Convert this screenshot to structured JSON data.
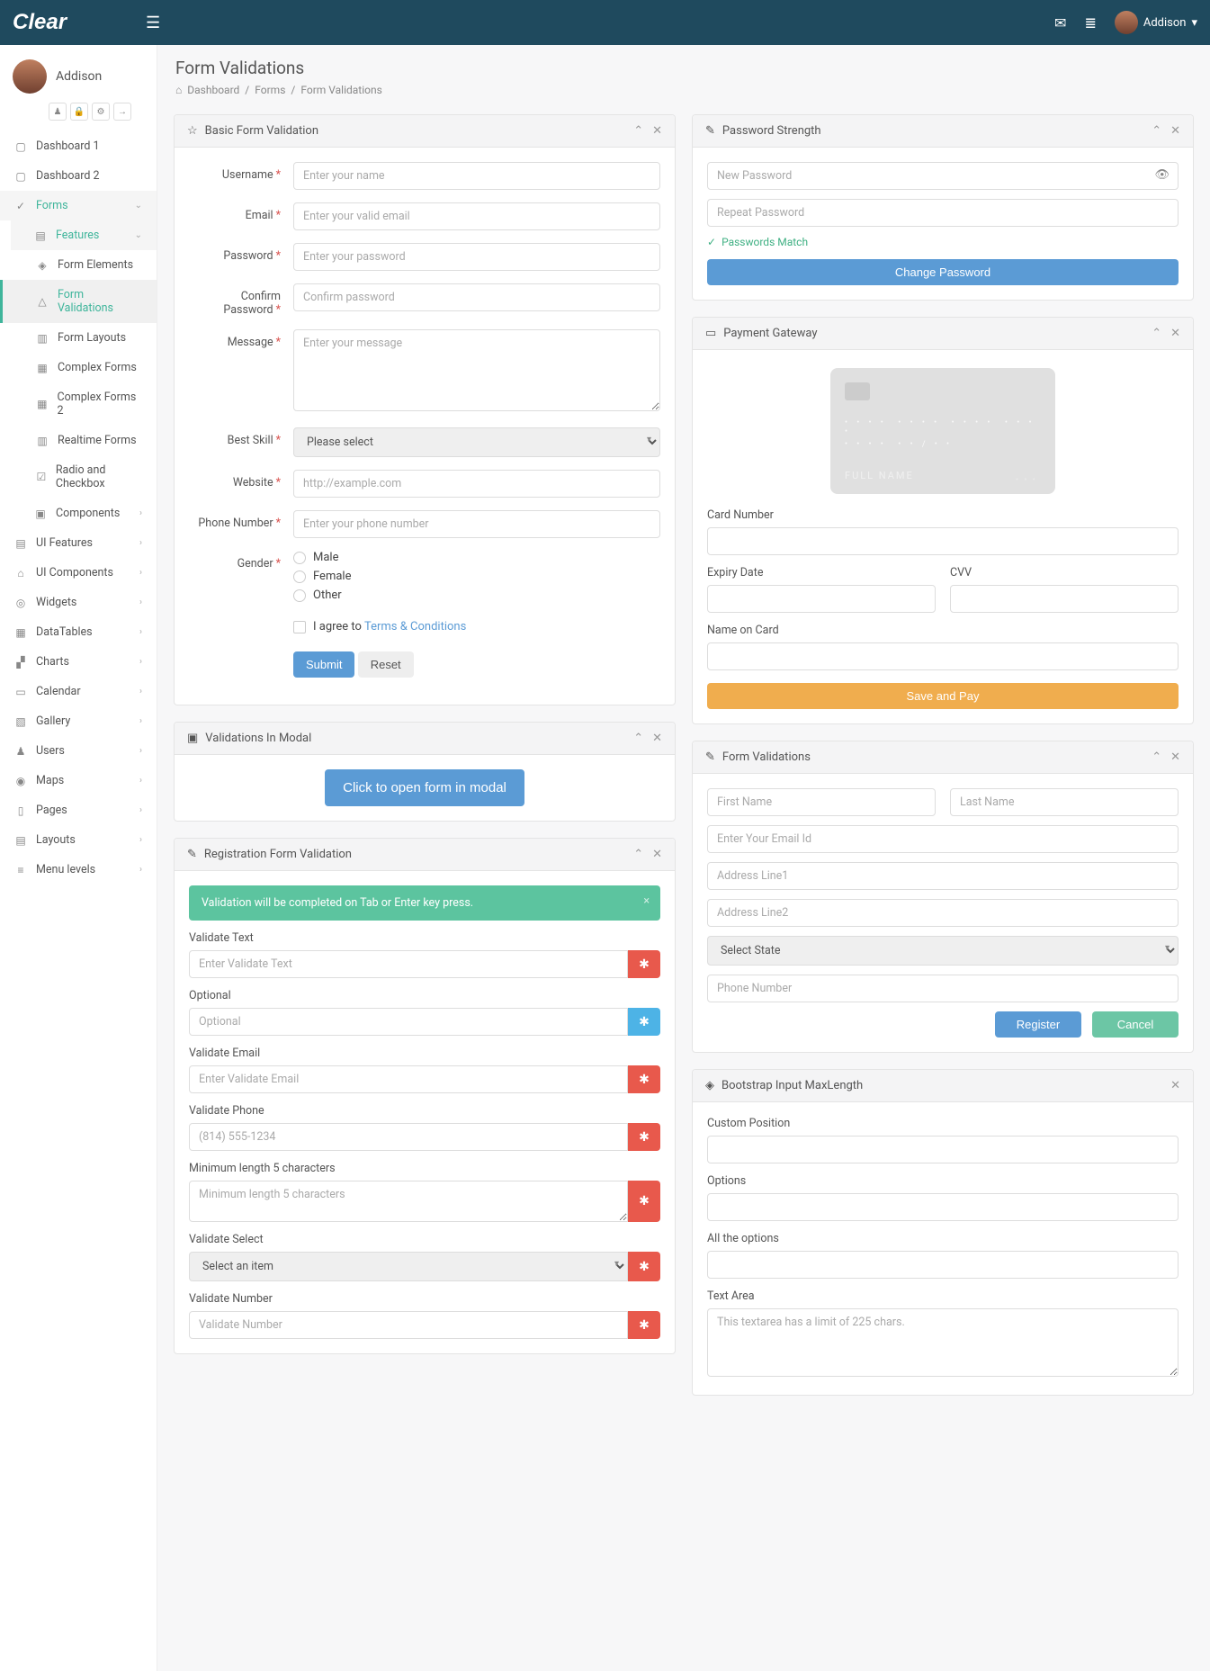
{
  "brand": "Clear",
  "user": {
    "name": "Addison"
  },
  "page": {
    "title": "Form Validations",
    "breadcrumb": [
      "Dashboard",
      "Forms",
      "Form Validations"
    ]
  },
  "sidebar": {
    "items": [
      {
        "label": "Dashboard 1",
        "icon": "▢"
      },
      {
        "label": "Dashboard 2",
        "icon": "▢"
      },
      {
        "label": "Forms",
        "icon": "✓",
        "active": true
      },
      {
        "label": "Features",
        "icon": "▤",
        "active": true,
        "sub": true
      },
      {
        "label": "Form Elements",
        "icon": "◈",
        "sub2": true
      },
      {
        "label": "Form Validations",
        "icon": "△",
        "sub2": true,
        "selected": true
      },
      {
        "label": "Form Layouts",
        "icon": "▥",
        "sub2": true
      },
      {
        "label": "Complex Forms",
        "icon": "▦",
        "sub2": true
      },
      {
        "label": "Complex Forms 2",
        "icon": "▦",
        "sub2": true
      },
      {
        "label": "Realtime Forms",
        "icon": "▥",
        "sub2": true
      },
      {
        "label": "Radio and Checkbox",
        "icon": "☑",
        "sub2": true
      },
      {
        "label": "Components",
        "icon": "▣",
        "chev": true,
        "sub": true
      },
      {
        "label": "UI Features",
        "icon": "▤",
        "chev": true
      },
      {
        "label": "UI Components",
        "icon": "⌂",
        "chev": true
      },
      {
        "label": "Widgets",
        "icon": "◎",
        "chev": true
      },
      {
        "label": "DataTables",
        "icon": "▦",
        "chev": true
      },
      {
        "label": "Charts",
        "icon": "▞",
        "chev": true
      },
      {
        "label": "Calendar",
        "icon": "▭",
        "chev": true
      },
      {
        "label": "Gallery",
        "icon": "▧",
        "chev": true
      },
      {
        "label": "Users",
        "icon": "♟",
        "chev": true
      },
      {
        "label": "Maps",
        "icon": "◉",
        "chev": true
      },
      {
        "label": "Pages",
        "icon": "▯",
        "chev": true
      },
      {
        "label": "Layouts",
        "icon": "▤",
        "chev": true
      },
      {
        "label": "Menu levels",
        "icon": "≡",
        "chev": true
      }
    ]
  },
  "basicForm": {
    "title": "Basic Form Validation",
    "username": {
      "label": "Username",
      "ph": "Enter your name"
    },
    "email": {
      "label": "Email",
      "ph": "Enter your valid email"
    },
    "password": {
      "label": "Password",
      "ph": "Enter your password"
    },
    "confirm": {
      "label": "Confirm Password",
      "ph": "Confirm password"
    },
    "message": {
      "label": "Message",
      "ph": "Enter your message"
    },
    "skill": {
      "label": "Best Skill",
      "ph": "Please select"
    },
    "website": {
      "label": "Website",
      "ph": "http://example.com"
    },
    "phone": {
      "label": "Phone Number",
      "ph": "Enter your phone number"
    },
    "gender": {
      "label": "Gender",
      "opts": [
        "Male",
        "Female",
        "Other"
      ]
    },
    "terms": {
      "prefix": "I agree to ",
      "link": "Terms & Conditions"
    },
    "submit": "Submit",
    "reset": "Reset"
  },
  "modalPanel": {
    "title": "Validations In Modal",
    "button": "Click to open form in modal"
  },
  "regForm": {
    "title": "Registration Form Validation",
    "alert": "Validation will be completed on Tab or Enter key press.",
    "fields": {
      "text": {
        "label": "Validate Text",
        "ph": "Enter Validate Text"
      },
      "optional": {
        "label": "Optional",
        "ph": "Optional"
      },
      "email": {
        "label": "Validate Email",
        "ph": "Enter Validate Email"
      },
      "phone": {
        "label": "Validate Phone",
        "ph": "(814) 555-1234"
      },
      "minlen": {
        "label": "Minimum length 5 characters",
        "ph": "Minimum length 5 characters"
      },
      "select": {
        "label": "Validate Select",
        "ph": "Select an item"
      },
      "number": {
        "label": "Validate Number",
        "ph": "Validate Number"
      }
    }
  },
  "pwStrength": {
    "title": "Password Strength",
    "newPh": "New Password",
    "repeatPh": "Repeat Password",
    "match": "Passwords Match",
    "button": "Change Password"
  },
  "payment": {
    "title": "Payment Gateway",
    "cardName": "FULL NAME",
    "labels": {
      "card": "Card Number",
      "expiry": "Expiry Date",
      "cvv": "CVV",
      "name": "Name on Card"
    },
    "button": "Save and Pay"
  },
  "formVal": {
    "title": "Form Validations",
    "ph": {
      "first": "First Name",
      "last": "Last Name",
      "email": "Enter Your Email Id",
      "addr1": "Address Line1",
      "addr2": "Address Line2",
      "state": "Select State",
      "phone": "Phone Number"
    },
    "register": "Register",
    "cancel": "Cancel"
  },
  "maxlen": {
    "title": "Bootstrap Input MaxLength",
    "labels": {
      "pos": "Custom Position",
      "opts": "Options",
      "all": "All the options",
      "ta": "Text Area"
    },
    "taPh": "This textarea has a limit of 225 chars."
  }
}
